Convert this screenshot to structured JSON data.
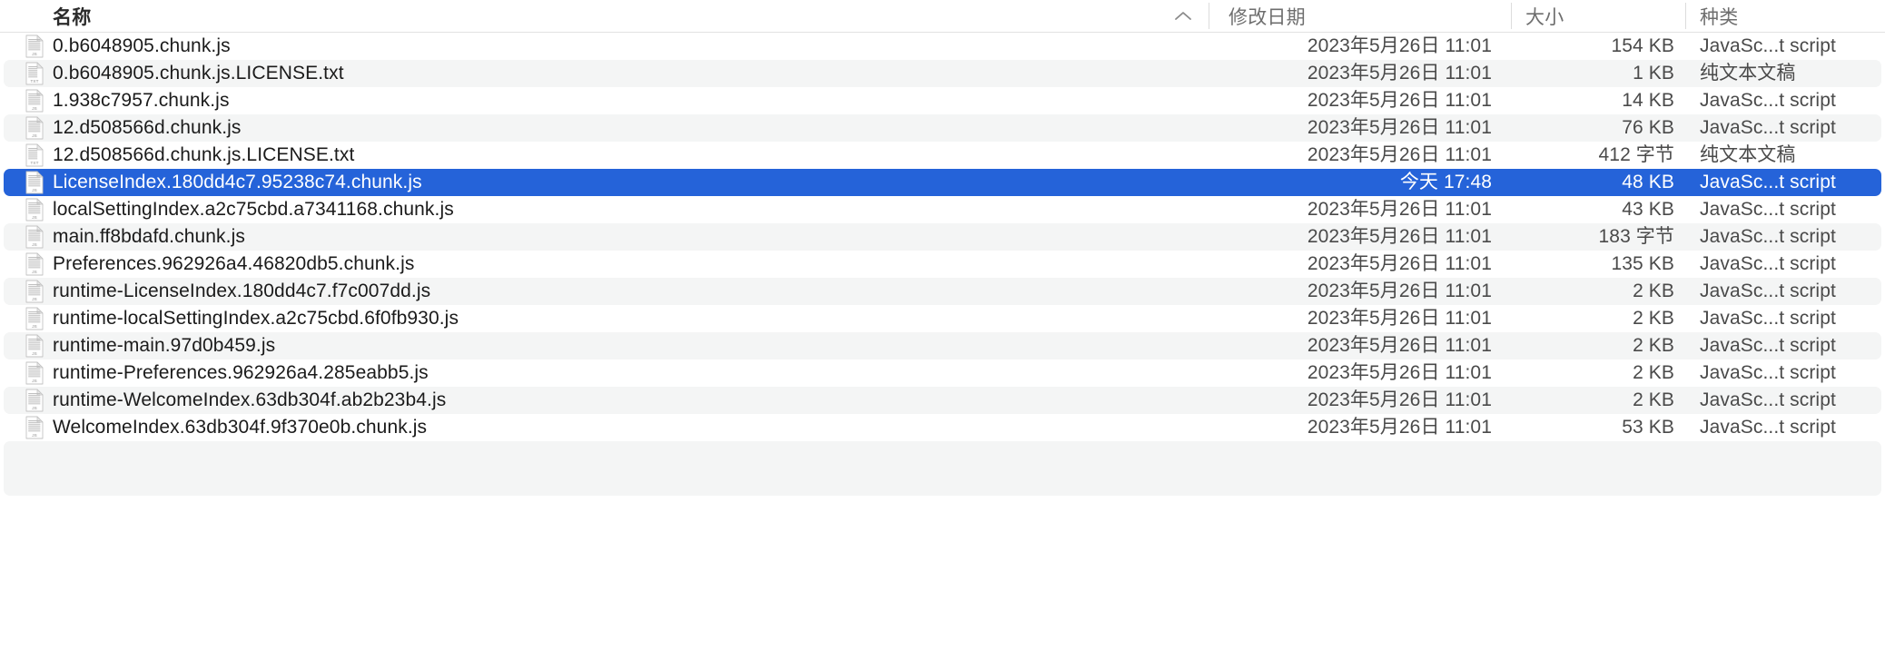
{
  "window": {
    "view": "finder-list-view"
  },
  "columns": {
    "name": "名称",
    "date_modified": "修改日期",
    "size": "大小",
    "kind": "种类",
    "sort_arrow": "⌃",
    "sort_column": "name",
    "sort_direction": "ascending"
  },
  "colors": {
    "selection": "#2563d9",
    "stripe": "#f4f5f5",
    "header_text": "#6e6e6e",
    "row_text": "#1b1b1b"
  },
  "rows": [
    {
      "name": "0.b6048905.chunk.js",
      "date": "2023年5月26日 11:01",
      "size": "154 KB",
      "kind": "JavaSc...t script",
      "icon": "js-file-icon",
      "selected": false
    },
    {
      "name": "0.b6048905.chunk.js.LICENSE.txt",
      "date": "2023年5月26日 11:01",
      "size": "1 KB",
      "kind": "纯文本文稿",
      "icon": "txt-file-icon",
      "selected": false
    },
    {
      "name": "1.938c7957.chunk.js",
      "date": "2023年5月26日 11:01",
      "size": "14 KB",
      "kind": "JavaSc...t script",
      "icon": "js-file-icon",
      "selected": false
    },
    {
      "name": "12.d508566d.chunk.js",
      "date": "2023年5月26日 11:01",
      "size": "76 KB",
      "kind": "JavaSc...t script",
      "icon": "js-file-icon",
      "selected": false
    },
    {
      "name": "12.d508566d.chunk.js.LICENSE.txt",
      "date": "2023年5月26日 11:01",
      "size": "412 字节",
      "kind": "纯文本文稿",
      "icon": "txt-file-icon",
      "selected": false
    },
    {
      "name": "LicenseIndex.180dd4c7.95238c74.chunk.js",
      "date": "今天 17:48",
      "size": "48 KB",
      "kind": "JavaSc...t script",
      "icon": "js-file-icon",
      "selected": true
    },
    {
      "name": "localSettingIndex.a2c75cbd.a7341168.chunk.js",
      "date": "2023年5月26日 11:01",
      "size": "43 KB",
      "kind": "JavaSc...t script",
      "icon": "js-file-icon",
      "selected": false
    },
    {
      "name": "main.ff8bdafd.chunk.js",
      "date": "2023年5月26日 11:01",
      "size": "183 字节",
      "kind": "JavaSc...t script",
      "icon": "js-file-icon",
      "selected": false
    },
    {
      "name": "Preferences.962926a4.46820db5.chunk.js",
      "date": "2023年5月26日 11:01",
      "size": "135 KB",
      "kind": "JavaSc...t script",
      "icon": "js-file-icon",
      "selected": false
    },
    {
      "name": "runtime-LicenseIndex.180dd4c7.f7c007dd.js",
      "date": "2023年5月26日 11:01",
      "size": "2 KB",
      "kind": "JavaSc...t script",
      "icon": "js-file-icon",
      "selected": false
    },
    {
      "name": "runtime-localSettingIndex.a2c75cbd.6f0fb930.js",
      "date": "2023年5月26日 11:01",
      "size": "2 KB",
      "kind": "JavaSc...t script",
      "icon": "js-file-icon",
      "selected": false
    },
    {
      "name": "runtime-main.97d0b459.js",
      "date": "2023年5月26日 11:01",
      "size": "2 KB",
      "kind": "JavaSc...t script",
      "icon": "js-file-icon",
      "selected": false
    },
    {
      "name": "runtime-Preferences.962926a4.285eabb5.js",
      "date": "2023年5月26日 11:01",
      "size": "2 KB",
      "kind": "JavaSc...t script",
      "icon": "js-file-icon",
      "selected": false
    },
    {
      "name": "runtime-WelcomeIndex.63db304f.ab2b23b4.js",
      "date": "2023年5月26日 11:01",
      "size": "2 KB",
      "kind": "JavaSc...t script",
      "icon": "js-file-icon",
      "selected": false
    },
    {
      "name": "WelcomeIndex.63db304f.9f370e0b.chunk.js",
      "date": "2023年5月26日 11:01",
      "size": "53 KB",
      "kind": "JavaSc...t script",
      "icon": "js-file-icon",
      "selected": false
    }
  ]
}
